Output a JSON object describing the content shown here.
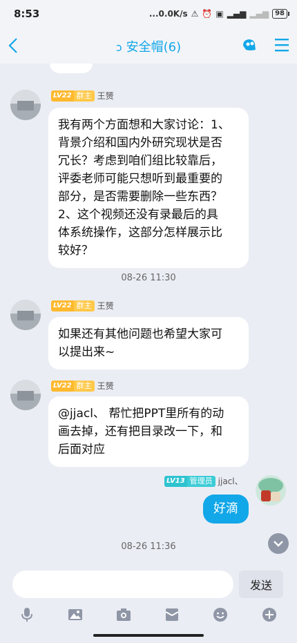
{
  "status_bar": {
    "time": "8:53",
    "network_speed": "...0.0K/s",
    "battery": "98"
  },
  "nav": {
    "title": "安全帽(6)",
    "accent_color": "#12a7e8"
  },
  "messages": [
    {
      "level": "LV22",
      "role": "群主",
      "sender": "王赟",
      "text": "我有两个方面想和大家讨论：1、\n背景介绍和国内外研究现状是否\n冗长？考虑到咱们组比较靠后，\n评委老师可能只想听到最重要的\n部分，是否需要删除一些东西？\n2、这个视频还没有录最后的具\n体系统操作，这部分怎样展示比\n较好？"
    },
    {
      "level": "LV22",
      "role": "群主",
      "sender": "王赟",
      "text": "如果还有其他问题也希望大家可\n以提出来~"
    },
    {
      "level": "LV22",
      "role": "群主",
      "sender": "王赟",
      "text": "@jjacl、 帮忙把PPT里所有的动\n画去掉，还有把目录改一下，和\n后面对应"
    },
    {
      "level": "LV13",
      "role": "管理员",
      "sender": "jjacl、",
      "text": "好滴"
    }
  ],
  "timestamps": [
    "08-26 11:30",
    "08-26 11:36"
  ],
  "input": {
    "placeholder": "",
    "send_label": "发送"
  },
  "toolbar_icons": [
    "microphone-icon",
    "image-icon",
    "camera-icon",
    "red-packet-icon",
    "emoji-icon",
    "plus-icon"
  ]
}
